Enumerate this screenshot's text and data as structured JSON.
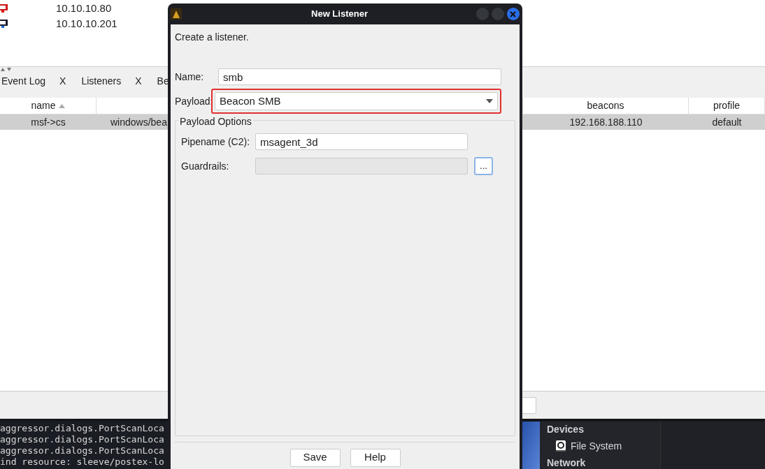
{
  "hosts": [
    {
      "address": "10.10.10.80",
      "alert": true
    },
    {
      "address": "10.10.10.201",
      "alert": false
    }
  ],
  "tabs": [
    {
      "label": "Event Log",
      "close": "X"
    },
    {
      "label": "Listeners",
      "close": "X"
    },
    {
      "label": "Be"
    }
  ],
  "table": {
    "columns": [
      {
        "label": "name",
        "sorted": true
      },
      {},
      {
        "label": "beacons"
      },
      {
        "label": "profile"
      }
    ],
    "rows": [
      {
        "selected": true,
        "cells": [
          "msf->cs",
          "windows/bea",
          "192.168.188.110",
          "default"
        ]
      }
    ]
  },
  "console": [
    "aggressor.dialogs.PortScanLoca",
    "aggressor.dialogs.PortScanLoca",
    "aggressor.dialogs.PortScanLoca",
    "ind resource: sleeve/postex-lo"
  ],
  "file_manager": {
    "sections": [
      {
        "title": "Devices",
        "items": [
          "File System"
        ]
      },
      {
        "title": "Network"
      }
    ]
  },
  "dialog": {
    "title": "New Listener",
    "intro": "Create a listener.",
    "name": {
      "label": "Name:",
      "value": "smb"
    },
    "payload": {
      "label": "Payload:",
      "value": "Beacon SMB",
      "highlighted": true
    },
    "group": "Payload Options",
    "fields": [
      {
        "label": "Pipename (C2):",
        "value": "msagent_3d",
        "disabled": false
      },
      {
        "label": "Guardrails:",
        "disabled": true,
        "button": "..."
      }
    ],
    "buttons": [
      "Save",
      "Help"
    ]
  }
}
